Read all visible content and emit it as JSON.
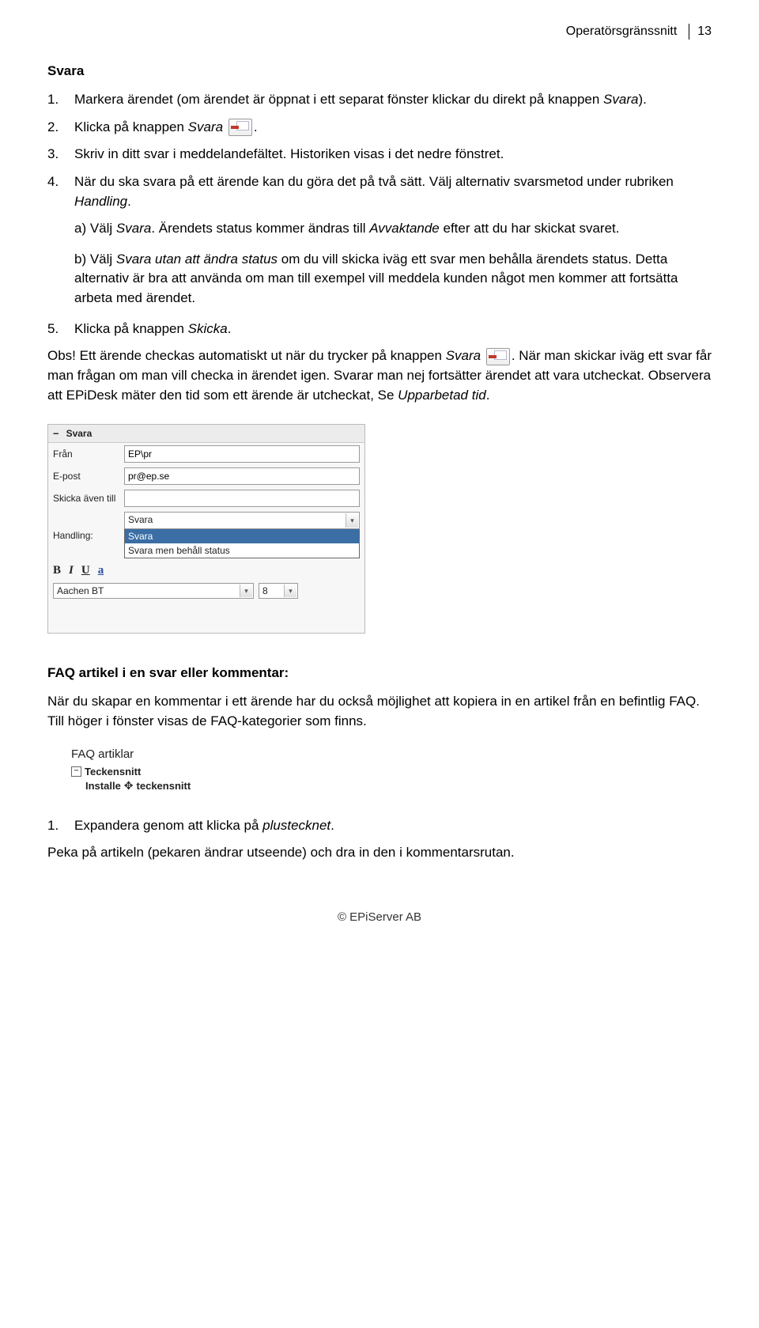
{
  "header": {
    "title": "Operatörsgränssnitt",
    "page": "13"
  },
  "section_title": "Svara",
  "steps": {
    "s1_num": "1.",
    "s1a": "Markera ärendet (om ärendet är öppnat i ett separat fönster klickar du direkt på knappen ",
    "s1b": "Svara",
    "s1c": ").",
    "s2_num": "2.",
    "s2a": "Klicka på knappen ",
    "s2b": "Svara",
    "s2c": ".",
    "s3_num": "3.",
    "s3": "Skriv in ditt svar i meddelandefältet. Historiken visas i det nedre fönstret.",
    "s4_num": "4.",
    "s4a": "När du ska svara på ett ärende kan du göra det på två sätt. Välj alternativ svarsmetod under rubriken ",
    "s4b": "Handling",
    "s4c": "."
  },
  "sub_a": {
    "a1": "a) Välj ",
    "a2": "Svara",
    "a3": ". Ärendets status kommer ändras till ",
    "a4": "Avvaktande",
    "a5": " efter att du har skickat svaret."
  },
  "sub_b": {
    "b1": "b) Välj ",
    "b2": "Svara utan att ändra status",
    "b3": " om du vill skicka iväg ett svar men behålla ärendets status. Detta alternativ är bra att använda om man till exempel vill meddela kunden något men kommer att fortsätta arbeta med ärendet."
  },
  "step5": {
    "num": "5.",
    "a": "Klicka på knappen ",
    "b": "Skicka",
    "c": "."
  },
  "obs": {
    "a": "Obs! Ett ärende checkas automatiskt ut när du trycker på knappen ",
    "b": "Svara",
    "c": ". När man skickar iväg ett svar får man frågan om man vill checka in ärendet igen. Svarar man nej fortsätter ärendet att vara utcheckat. Observera att EPiDesk mäter den tid som ett ärende är utcheckat, Se ",
    "d": "Upparbetad tid",
    "e": "."
  },
  "form": {
    "collapse": "−",
    "title": "Svara",
    "labels": {
      "from": "Från",
      "email": "E-post",
      "cc": "Skicka även till",
      "handling": "Handling:"
    },
    "values": {
      "from": "EP\\pr",
      "email": "pr@ep.se",
      "cc": "",
      "handling": "Svara"
    },
    "options": {
      "opt1": "Svara",
      "opt2": "Svara men behåll status"
    },
    "toolbar": {
      "b": "B",
      "i": "I",
      "u": "U",
      "a": "a"
    },
    "font": "Aachen BT",
    "size": "8"
  },
  "faq": {
    "heading": "FAQ artikel i en svar eller kommentar:",
    "intro": "När du skapar en kommentar i ett ärende har du också möjlighet att kopiera in en artikel från en befintlig FAQ. Till höger i fönster visas de FAQ-kategorier som finns.",
    "panel_title": "FAQ artiklar",
    "minus": "−",
    "node1": "Teckensnitt",
    "leaf_a": "Installe",
    "leaf_b": " teckensnitt",
    "step_num": "1.",
    "step_a": "Expandera genom att klicka på ",
    "step_b": "plustecknet",
    "step_c": ".",
    "drag": "Peka på artikeln (pekaren ändrar utseende) och dra in den i kommentarsrutan."
  },
  "footer": "© EPiServer AB"
}
